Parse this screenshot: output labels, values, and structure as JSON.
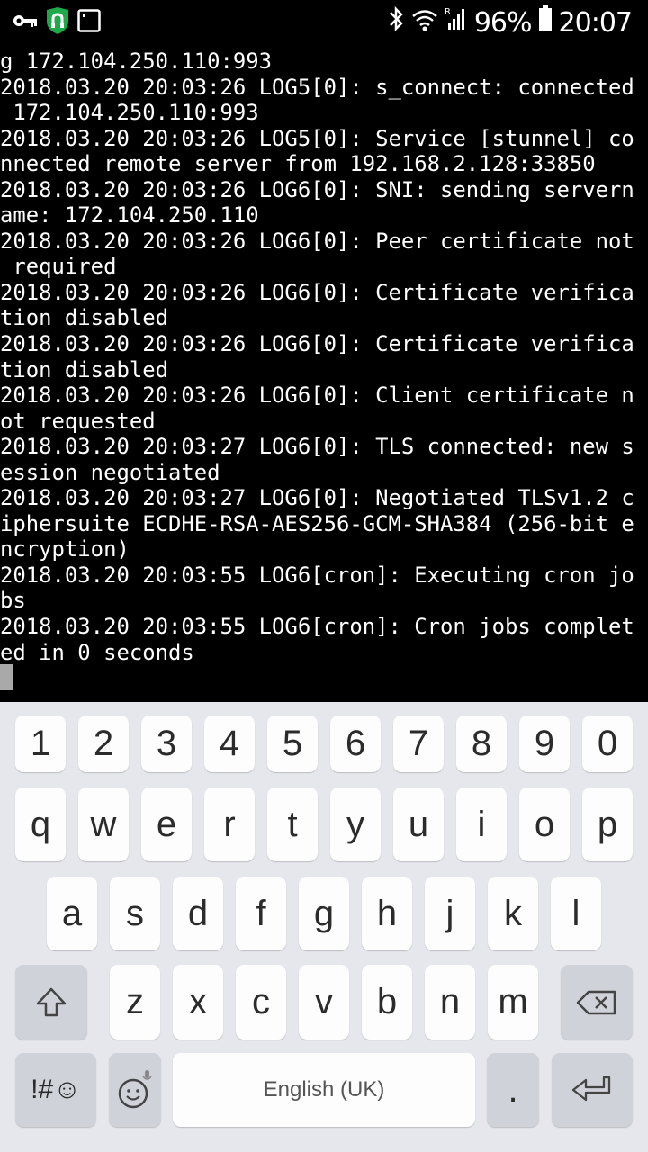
{
  "status_bar": {
    "battery_percent": "96%",
    "time": "20:07",
    "icons": [
      "vpn-key-icon",
      "shield-app-icon",
      "window-icon",
      "bluetooth-icon",
      "wifi-icon",
      "signal-icon",
      "battery-icon"
    ]
  },
  "terminal": {
    "lines": [
      "g 172.104.250.110:993",
      "2018.03.20 20:03:26 LOG5[0]: s_connect: connected",
      " 172.104.250.110:993",
      "2018.03.20 20:03:26 LOG5[0]: Service [stunnel] co",
      "nnected remote server from 192.168.2.128:33850",
      "2018.03.20 20:03:26 LOG6[0]: SNI: sending servern",
      "ame: 172.104.250.110",
      "2018.03.20 20:03:26 LOG6[0]: Peer certificate not",
      " required",
      "2018.03.20 20:03:26 LOG6[0]: Certificate verifica",
      "tion disabled",
      "2018.03.20 20:03:26 LOG6[0]: Certificate verifica",
      "tion disabled",
      "2018.03.20 20:03:26 LOG6[0]: Client certificate n",
      "ot requested",
      "2018.03.20 20:03:27 LOG6[0]: TLS connected: new s",
      "ession negotiated",
      "2018.03.20 20:03:27 LOG6[0]: Negotiated TLSv1.2 c",
      "iphersuite ECDHE-RSA-AES256-GCM-SHA384 (256-bit e",
      "ncryption)",
      "2018.03.20 20:03:55 LOG6[cron]: Executing cron jo",
      "bs",
      "2018.03.20 20:03:55 LOG6[cron]: Cron jobs complet",
      "ed in 0 seconds"
    ]
  },
  "keyboard": {
    "number_row": [
      "1",
      "2",
      "3",
      "4",
      "5",
      "6",
      "7",
      "8",
      "9",
      "0"
    ],
    "row1": [
      "q",
      "w",
      "e",
      "r",
      "t",
      "y",
      "u",
      "i",
      "o",
      "p"
    ],
    "row2": [
      "a",
      "s",
      "d",
      "f",
      "g",
      "h",
      "j",
      "k",
      "l"
    ],
    "row3": [
      "z",
      "x",
      "c",
      "v",
      "b",
      "n",
      "m"
    ],
    "symbols_label": "!#☺",
    "space_label": "English (UK)",
    "period_label": "."
  }
}
